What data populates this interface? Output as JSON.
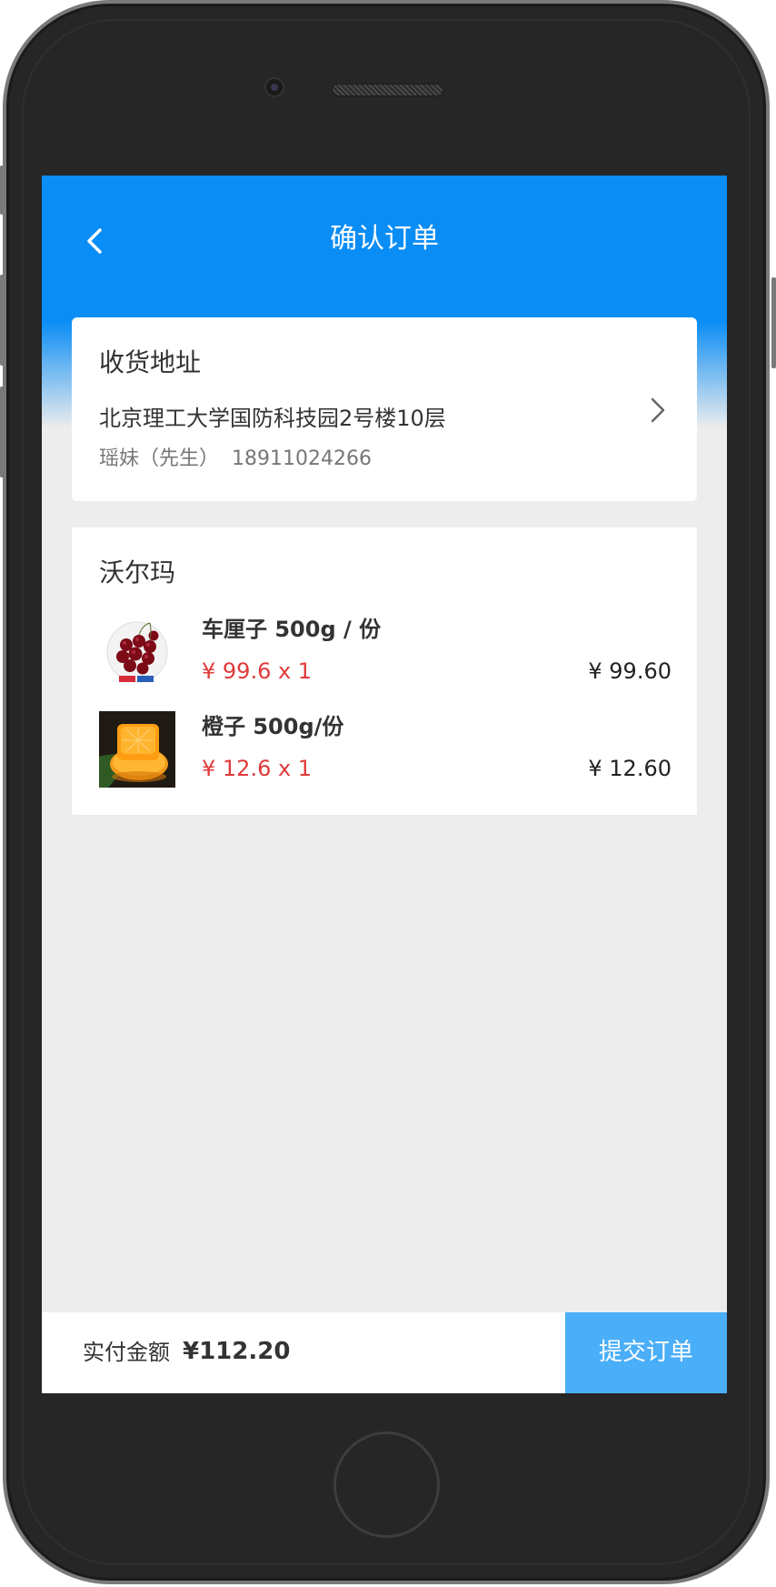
{
  "nav": {
    "title": "确认订单",
    "back_icon": "chevron-left-icon"
  },
  "address": {
    "heading": "收货地址",
    "text": "北京理工大学国防科技园2号楼10层",
    "contact": "瑶妹（先生）  18911024266",
    "chevron_icon": "chevron-right-icon"
  },
  "store": {
    "name": "沃尔玛",
    "items": [
      {
        "name": "车厘子 500g / 份",
        "price_qty": "¥ 99.6 x 1",
        "subtotal": "¥ 99.60",
        "image": "cherries"
      },
      {
        "name": "橙子 500g/份",
        "price_qty": "¥ 12.6 x 1",
        "subtotal": "¥ 12.60",
        "image": "orange"
      }
    ]
  },
  "footer": {
    "total_label": "实付金额",
    "total_amount": "¥112.20",
    "submit_label": "提交订单"
  },
  "colors": {
    "primary": "#0a8df5",
    "submit": "#4aaef8",
    "price": "#e03a3a",
    "background": "#ededed"
  }
}
